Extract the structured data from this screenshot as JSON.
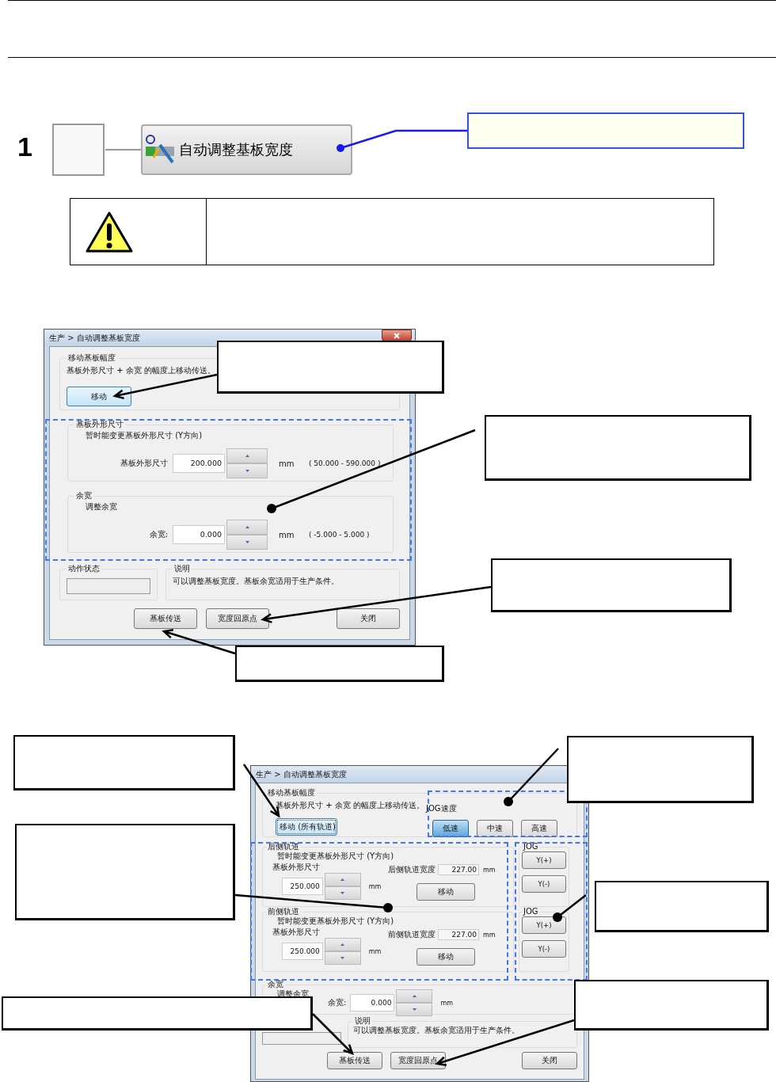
{
  "step": {
    "number": "1",
    "button_label": "自动调整基板宽度"
  },
  "dialog_1": {
    "title": "生产 > 自动调整基板宽度",
    "move_group": {
      "title": "移动基板幅度",
      "description": "基板外形尺寸 + 余宽 的幅度上移动传送。",
      "button": {
        "label": "移动",
        "focused": true
      }
    },
    "board_size_group": {
      "title": "基板外形尺寸",
      "description": "暂时能变更基板外形尺寸 (Y方向)",
      "label": "基板外形尺寸",
      "value": "200.000",
      "unit": "mm",
      "range": "( 50.000 - 590.000 )"
    },
    "margin_group": {
      "title": "余宽",
      "description": "调整余宽",
      "label": "余宽:",
      "value": "0.000",
      "unit": "mm",
      "range": "( -5.000 - 5.000 )"
    },
    "status_group": {
      "title": "动作状态"
    },
    "note_group": {
      "title": "说明",
      "text": "可以调整基板宽度。基板余宽适用于生产条件。"
    },
    "buttons": [
      "基板传送",
      "宽度回原点",
      "关闭"
    ]
  },
  "dialog_2": {
    "title": "生产 > 自动调整基板宽度",
    "move_group": {
      "title": "移动基板幅度",
      "description": "基板外形尺寸 + 余宽 的幅度上移动传送。",
      "button": {
        "label": "移动 (所有轨道)",
        "focused": true
      }
    },
    "jog_speed": {
      "title": "JOG速度",
      "options": [
        {
          "label": "低速",
          "selected": true
        },
        {
          "label": "中速",
          "selected": false
        },
        {
          "label": "高速",
          "selected": false
        }
      ]
    },
    "rails": [
      {
        "title": "后侧轨道",
        "description": "暂时能变更基板外形尺寸 (Y方向)",
        "label": "基板外形尺寸",
        "value": "250.000",
        "unit": "mm",
        "width_label": "后侧轨道宽度",
        "width_value": "227.00",
        "width_unit": "mm",
        "button": "移动",
        "jog_title": "JOG",
        "jog_buttons": [
          "Y(+)",
          "Y(-)"
        ]
      },
      {
        "title": "前侧轨道",
        "description": "暂时能变更基板外形尺寸 (Y方向)",
        "label": "基板外形尺寸",
        "value": "250.000",
        "unit": "mm",
        "width_label": "前侧轨道宽度",
        "width_value": "227.00",
        "width_unit": "mm",
        "button": "移动",
        "jog_title": "JOG",
        "jog_buttons": [
          "Y(+)",
          "Y(-)"
        ]
      }
    ],
    "margin_group": {
      "title": "余宽",
      "description": "调整余宽",
      "label": "余宽:",
      "value": "0.000",
      "unit": "mm"
    },
    "note_group": {
      "title": "说明",
      "text": "可以调整基板宽度。基板余宽适用于生产条件。"
    },
    "buttons": [
      "基板传送",
      "宽度回原点",
      "关闭"
    ]
  }
}
